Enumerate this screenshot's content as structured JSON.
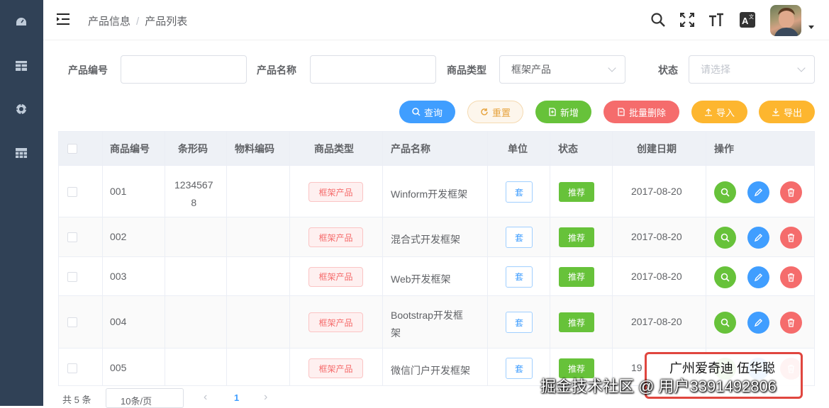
{
  "breadcrumb": {
    "first": "产品信息",
    "separator": "/",
    "second": "产品列表"
  },
  "header_icons": [
    "search-icon",
    "fullscreen-icon",
    "font-size-icon",
    "translate-icon"
  ],
  "sidebar_icons": [
    "dashboard-icon",
    "table-icon",
    "settings-icon",
    "grid-icon"
  ],
  "filters": {
    "product_code_label": "产品编号",
    "product_code_value": "",
    "product_name_label": "产品名称",
    "product_name_value": "",
    "goods_type_label": "商品类型",
    "goods_type_value": "框架产品",
    "status_label": "状态",
    "status_placeholder": "请选择"
  },
  "buttons": {
    "query": "查询",
    "reset": "重置",
    "add": "新增",
    "batch_delete": "批量删除",
    "import": "导入",
    "export": "导出"
  },
  "colors": {
    "sidebar": "#304156",
    "primary": "#409eff",
    "success": "#67c23a",
    "danger": "#f56c6c",
    "warning": "#e6a23c",
    "import_export": "#fdb62f"
  },
  "table": {
    "headers": {
      "goods_code": "商品编号",
      "barcode": "条形码",
      "material_code": "物料编码",
      "goods_type": "商品类型",
      "product_name": "产品名称",
      "unit": "单位",
      "status": "状态",
      "created": "创建日期",
      "actions": "操作"
    },
    "rows": [
      {
        "code": "001",
        "barcode_l1": "1234567",
        "barcode_l2": "8",
        "type": "框架产品",
        "name_l1": "Winform开发框架",
        "name_l2": "",
        "unit": "套",
        "status": "推荐",
        "date": "2017-08-20"
      },
      {
        "code": "002",
        "barcode_l1": "",
        "barcode_l2": "",
        "type": "框架产品",
        "name_l1": "混合式开发框架",
        "name_l2": "",
        "unit": "套",
        "status": "推荐",
        "date": "2017-08-20"
      },
      {
        "code": "003",
        "barcode_l1": "",
        "barcode_l2": "",
        "type": "框架产品",
        "name_l1": "Web开发框架",
        "name_l2": "",
        "unit": "套",
        "status": "推荐",
        "date": "2017-08-20"
      },
      {
        "code": "004",
        "barcode_l1": "",
        "barcode_l2": "",
        "type": "框架产品",
        "name_l1": "Bootstrap开发框",
        "name_l2": "架",
        "unit": "套",
        "status": "推荐",
        "date": "2017-08-20"
      },
      {
        "code": "005",
        "barcode_l1": "",
        "barcode_l2": "",
        "type": "框架产品",
        "name_l1": "微信门户开发框架",
        "name_l2": "",
        "unit": "套",
        "status": "推荐",
        "date": "19"
      }
    ]
  },
  "pagination": {
    "total": "共 5 条",
    "page_size": "10条/页",
    "current_page": "1"
  },
  "watermark": {
    "line1": "广州爱奇迪 伍华聪",
    "line2": "掘金技术社区 @ 用户3391492806"
  }
}
